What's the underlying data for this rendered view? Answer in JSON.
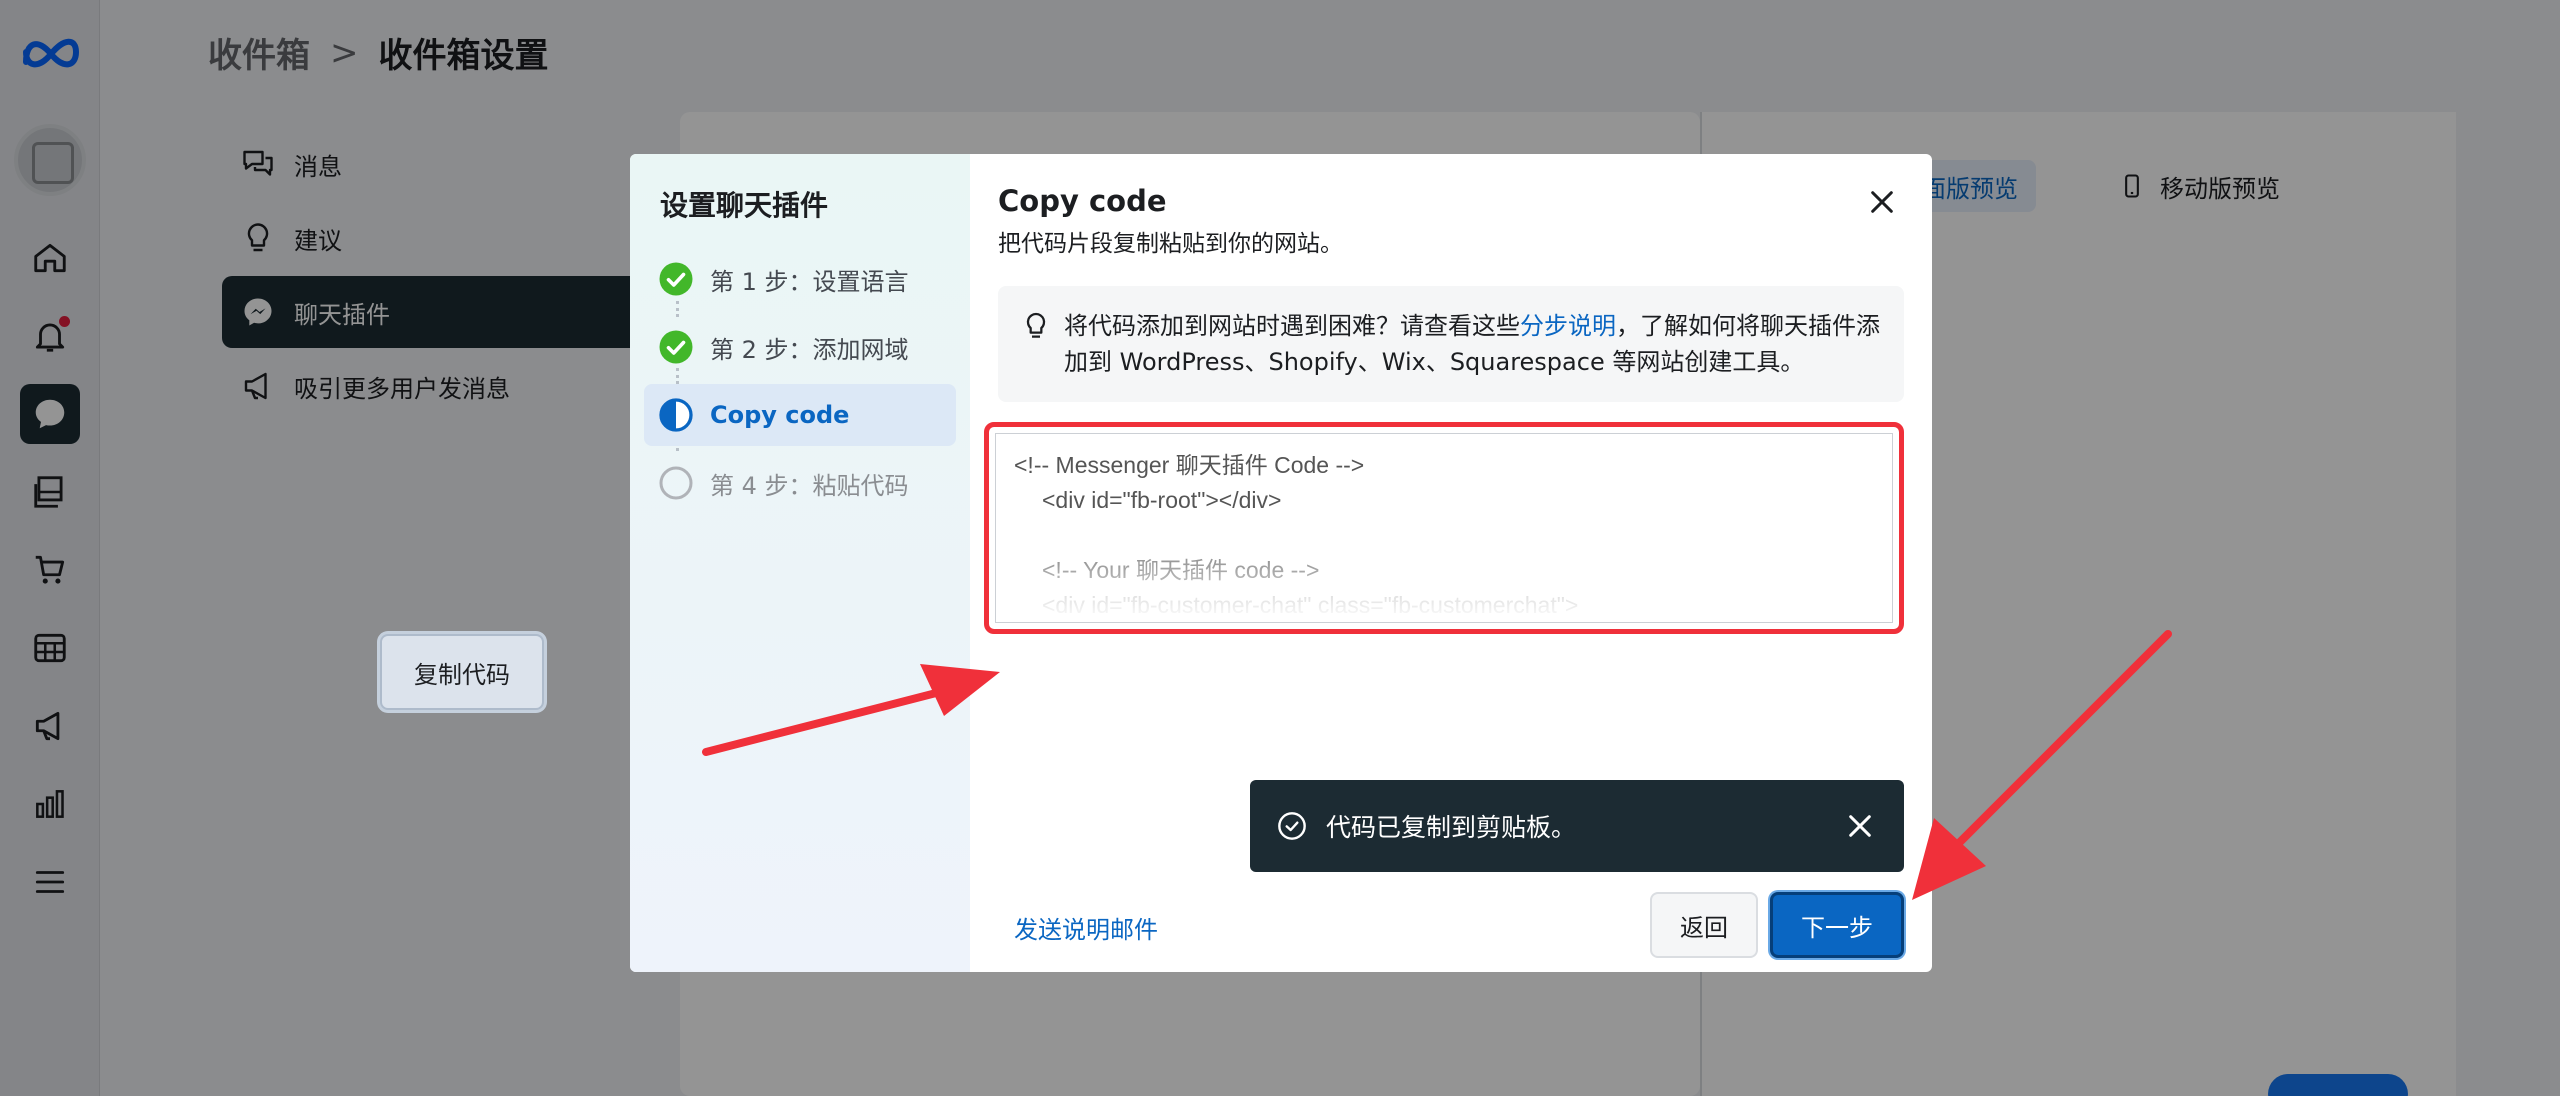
{
  "breadcrumb": {
    "root": "收件箱",
    "separator": ">",
    "current": "收件箱设置"
  },
  "settings_nav": [
    {
      "label": "消息",
      "icon": "chat-bubbles-icon"
    },
    {
      "label": "建议",
      "icon": "lightbulb-icon"
    },
    {
      "label": "聊天插件",
      "icon": "messenger-icon",
      "active": true
    },
    {
      "label": "吸引更多用户发消息",
      "icon": "megaphone-icon"
    }
  ],
  "preview_tabs": {
    "desktop": "桌面版预览",
    "mobile": "移动版预览"
  },
  "modal": {
    "title": "设置聊天插件",
    "steps": [
      {
        "label": "第 1 步：设置语言",
        "state": "done"
      },
      {
        "label": "第 2 步：添加网域",
        "state": "done"
      },
      {
        "label": "Copy code",
        "state": "current"
      },
      {
        "label": "第 4 步：粘贴代码",
        "state": "todo"
      }
    ],
    "heading": "Copy code",
    "subheading": "把代码片段复制粘贴到你的网站。",
    "tip": {
      "before": "将代码添加到网站时遇到困难？请查看这些",
      "link": "分步说明",
      "after": "，了解如何将聊天插件添加到 WordPress、Shopify、Wix、Squarespace 等网站创建工具。"
    },
    "code_lines": [
      "<!-- Messenger 聊天插件 Code -->",
      "<div id=\"fb-root\"></div>",
      "",
      "<!-- Your 聊天插件 code -->",
      "<div id=\"fb-customer-chat\" class=\"fb-customerchat\">"
    ],
    "copy_button": "复制代码",
    "toast": "代码已复制到剪贴板。",
    "email_link": "发送说明邮件",
    "back_button": "返回",
    "next_button": "下一步"
  },
  "colors": {
    "accent": "#0a66c2",
    "highlight": "#f0303a",
    "dark": "#1c2b33",
    "success": "#42b72a"
  }
}
